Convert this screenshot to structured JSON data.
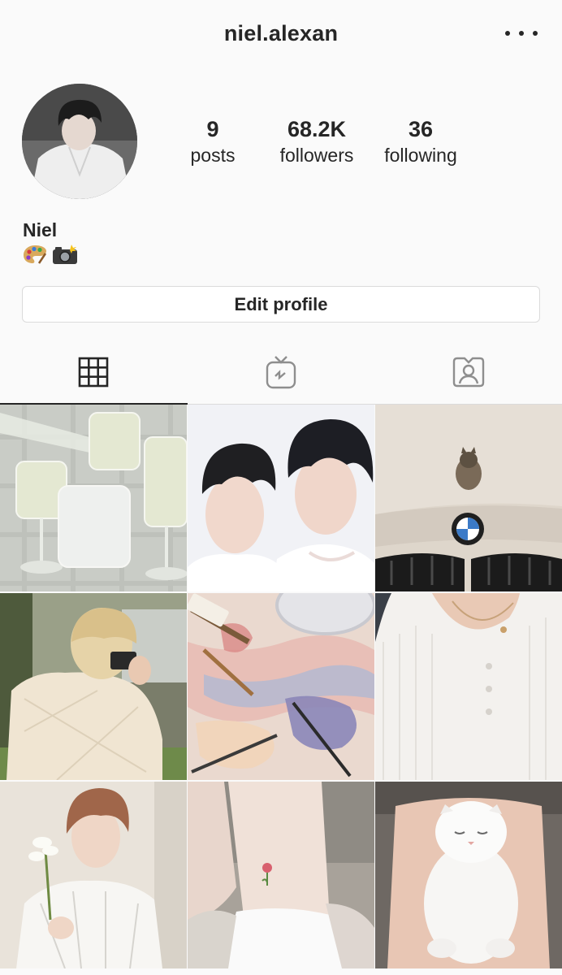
{
  "header": {
    "username": "niel.alexan",
    "more_icon": "more-horizontal-icon"
  },
  "profile": {
    "stats": {
      "posts": {
        "value": "9",
        "label": "posts"
      },
      "followers": {
        "value": "68.2K",
        "label": "followers"
      },
      "following": {
        "value": "36",
        "label": "following"
      }
    },
    "name": "Niel",
    "bio_icons": [
      "palette-icon",
      "camera-flash-icon"
    ],
    "edit_label": "Edit profile"
  },
  "tabs": [
    {
      "icon": "grid-icon",
      "active": true
    },
    {
      "icon": "igtv-icon",
      "active": false
    },
    {
      "icon": "tagged-icon",
      "active": false
    }
  ],
  "posts": [
    {
      "subject": "glasses-of-white-drink"
    },
    {
      "subject": "two-boys-portrait"
    },
    {
      "subject": "kitten-on-car-hood"
    },
    {
      "subject": "blond-boy-with-camera"
    },
    {
      "subject": "paint-palette-and-brushes"
    },
    {
      "subject": "white-henley-shirt"
    },
    {
      "subject": "boy-holding-flower"
    },
    {
      "subject": "flower-ankle-tattoo"
    },
    {
      "subject": "white-cat-lying"
    }
  ],
  "colors": {
    "background": "#fafafa",
    "text": "#262626",
    "border": "#dbdbdb"
  }
}
